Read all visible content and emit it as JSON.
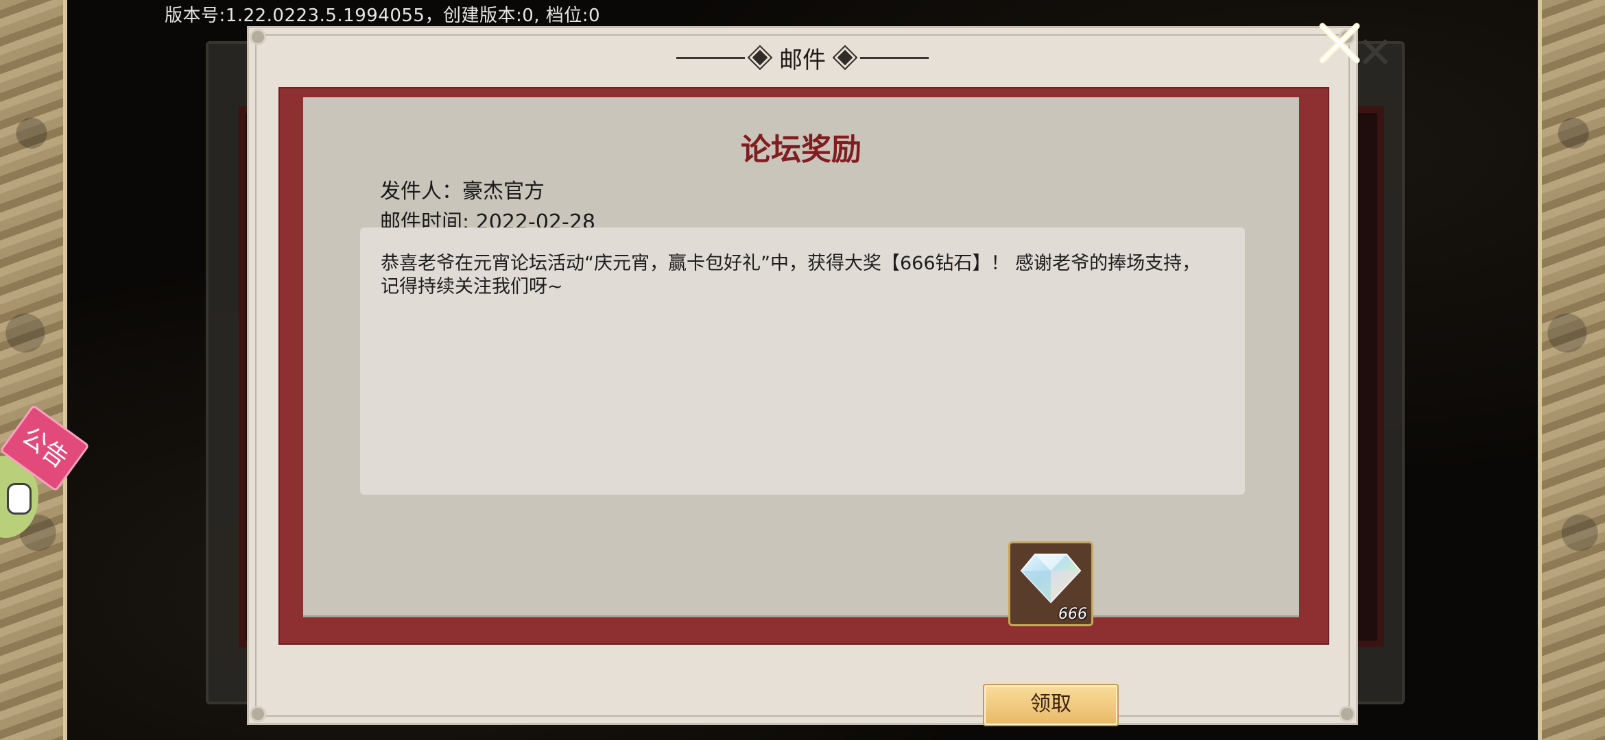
{
  "version_text": "版本号:1.22.0223.5.1994055，创建版本:0, 档位:0",
  "dialog": {
    "title": "邮件",
    "close_icon": "close-x-icon"
  },
  "mail": {
    "subject": "论坛奖励",
    "sender_label": "发件人：",
    "sender": "豪杰官方",
    "time_label": "邮件时间: ",
    "time": "2022-02-28",
    "body": "恭喜老爷在元宵论坛活动“庆元宵，赢卡包好礼”中，获得大奖【666钻石】！ 感谢老爷的捧场支持，记得持续关注我们呀~"
  },
  "attachments": [
    {
      "icon": "diamond-gem-icon",
      "count": "666"
    }
  ],
  "claim_button_label": "领取",
  "announcement": {
    "label": "公告"
  }
}
